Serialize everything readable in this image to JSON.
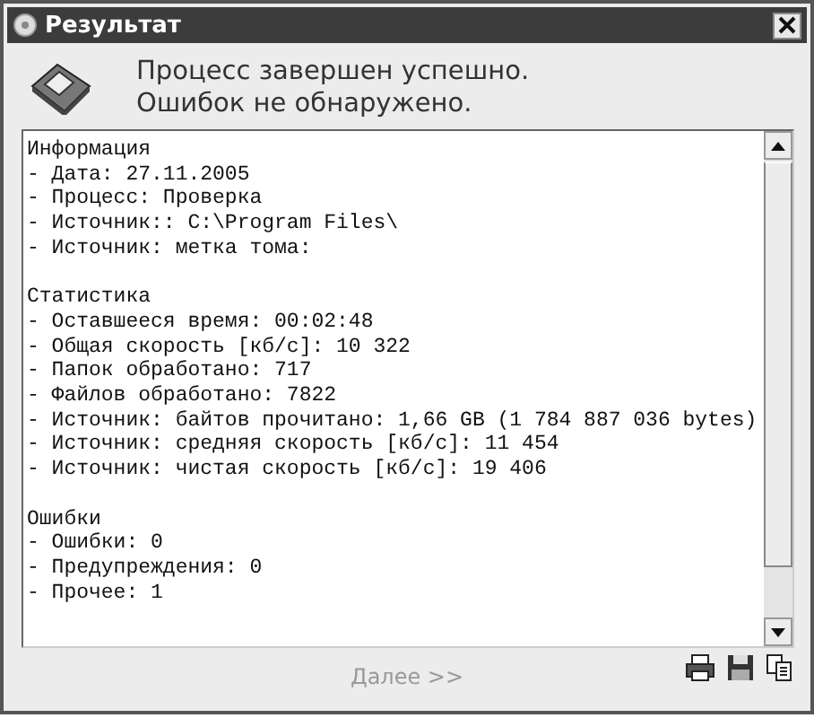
{
  "window": {
    "title": "Результат"
  },
  "header": {
    "lines": [
      "Процесс завершен успешно.",
      "Ошибок не обнаружено."
    ]
  },
  "report": [
    {
      "title": "Информация",
      "items": [
        "- Дата: 27.11.2005",
        "- Процесс: Проверка",
        "- Источник:: C:\\Program Files\\",
        "- Источник: метка тома:"
      ]
    },
    {
      "title": "Статистика",
      "items": [
        "- Оставшееся время: 00:02:48",
        "- Общая скорость [кб/с]: 10 322",
        "- Папок обработано: 717",
        "- Файлов обработано: 7822",
        "- Источник: байтов прочитано: 1,66 GB (1 784 887 036 bytes)",
        "- Источник: средняя скорость [кб/с]: 11 454",
        "- Источник: чистая скорость [кб/с]: 19 406"
      ]
    },
    {
      "title": "Ошибки",
      "items": [
        "- Ошибки: 0",
        "- Предупреждения: 0",
        "- Прочее: 1"
      ]
    }
  ],
  "next_button": {
    "label": "Далее >>",
    "disabled": true
  }
}
